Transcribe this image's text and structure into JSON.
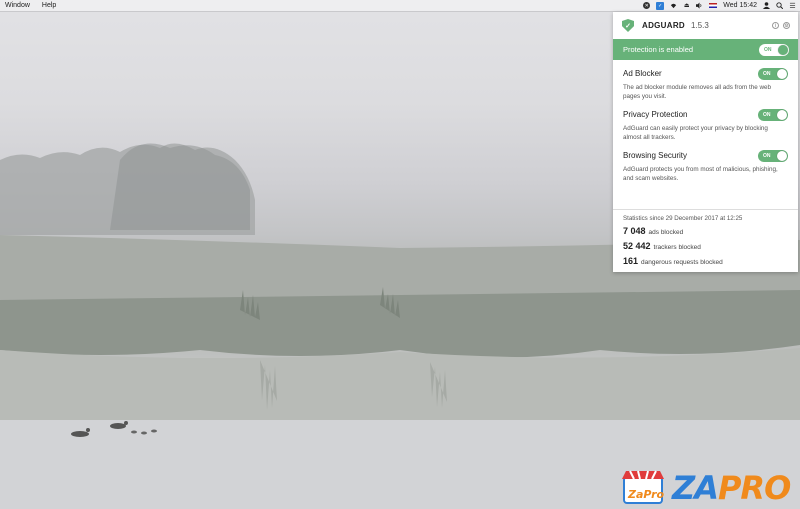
{
  "menubar": {
    "items": [
      "Window",
      "Help"
    ],
    "clock": "Wed 15:42",
    "status_icons": [
      "cross-circle-icon",
      "adguard-shield-icon",
      "wifi-icon",
      "eject-icon",
      "volume-icon",
      "us-flag-icon",
      "user-icon",
      "search-icon",
      "list-icon"
    ]
  },
  "panel": {
    "brand": "ADGUARD",
    "version": "1.5.3",
    "protection": {
      "label": "Protection is enabled",
      "toggle": "ON"
    },
    "modules": [
      {
        "title": "Ad Blocker",
        "toggle": "ON",
        "description": "The ad blocker module removes all ads from the web pages you visit."
      },
      {
        "title": "Privacy Protection",
        "toggle": "ON",
        "description": "AdGuard can easily protect your privacy by blocking almost all trackers."
      },
      {
        "title": "Browsing Security",
        "toggle": "ON",
        "description": "AdGuard protects you from most of malicious, phishing, and scam websites."
      }
    ],
    "stats": {
      "since": "Statistics since 29 December 2017 at 12:25",
      "rows": [
        {
          "value": "7 048",
          "label": "ads blocked"
        },
        {
          "value": "52 442",
          "label": "trackers blocked"
        },
        {
          "value": "161",
          "label": "dangerous requests blocked"
        }
      ]
    }
  },
  "watermark": {
    "za": "ZA",
    "pro": "PRO",
    "logo_text": "ZaPro"
  },
  "colors": {
    "accent_green": "#67b279",
    "watermark_blue": "#2f7fd6",
    "watermark_orange": "#f08a1c"
  }
}
